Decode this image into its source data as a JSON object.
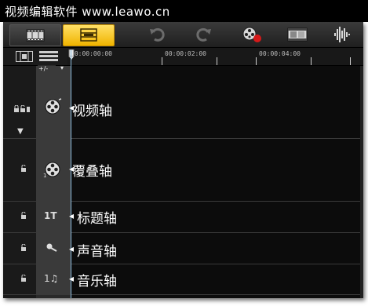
{
  "window": {
    "title": "视频编辑软件   www.leawo.cn"
  },
  "toolbar": {
    "storyboard_view": "storyboard-view-icon",
    "timeline_view": "timeline-view-icon",
    "undo": "undo-icon",
    "redo": "redo-icon",
    "record_capture": "record-icon",
    "batch_convert": "film-grid-icon",
    "audio_mixer": "audio-wave-icon"
  },
  "timeline": {
    "zoom_label": "+/-",
    "timecodes": [
      "00:00:00:00",
      "00:00:02:00",
      "00:00:04:00"
    ]
  },
  "tracks": [
    {
      "id": "video",
      "label": "视频轴",
      "icon": "film-reel-icon"
    },
    {
      "id": "overlay",
      "label": "覆叠轴",
      "icon": "overlay-reel-icon"
    },
    {
      "id": "title",
      "label": "标题轴",
      "icon": "title-t-icon",
      "badge": "1T"
    },
    {
      "id": "voice",
      "label": "声音轴",
      "icon": "microphone-icon"
    },
    {
      "id": "music",
      "label": "音乐轴",
      "icon": "music-note-icon",
      "badge": "1♫"
    }
  ],
  "colors": {
    "timeline_active": "#f0b400",
    "playhead": "#8fbfe0",
    "background": "#0c0c0c"
  }
}
